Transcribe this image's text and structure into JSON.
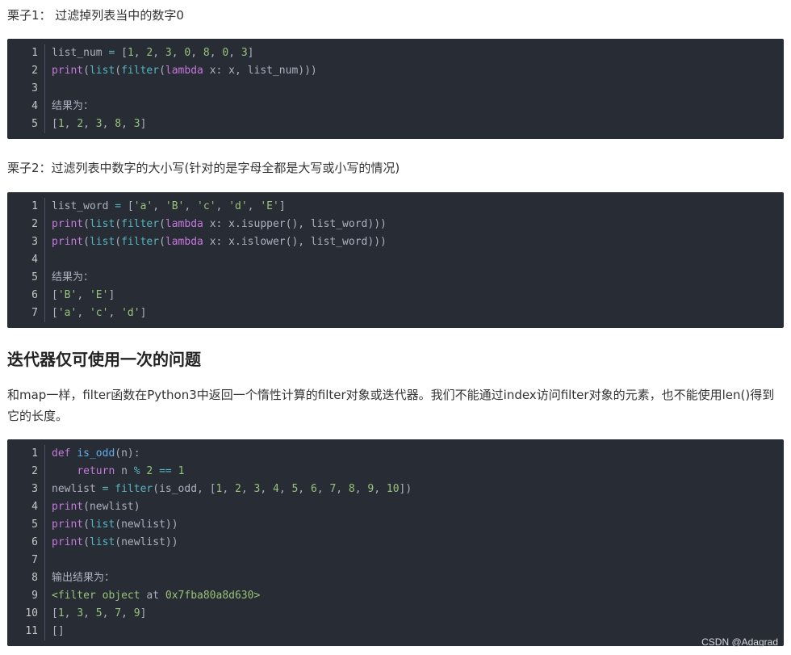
{
  "example1": {
    "title": "栗子1： 过滤掉列表当中的数字0",
    "lines": [
      {
        "num": "1",
        "tokens": [
          [
            "p",
            "list_num "
          ],
          [
            "o",
            "="
          ],
          [
            "p",
            " ["
          ],
          [
            "n",
            "1"
          ],
          [
            "p",
            ", "
          ],
          [
            "n",
            "2"
          ],
          [
            "p",
            ", "
          ],
          [
            "n",
            "3"
          ],
          [
            "p",
            ", "
          ],
          [
            "n",
            "0"
          ],
          [
            "p",
            ", "
          ],
          [
            "n",
            "8"
          ],
          [
            "p",
            ", "
          ],
          [
            "n",
            "0"
          ],
          [
            "p",
            ", "
          ],
          [
            "n",
            "3"
          ],
          [
            "p",
            "]"
          ]
        ]
      },
      {
        "num": "2",
        "tokens": [
          [
            "k",
            "print"
          ],
          [
            "p",
            "("
          ],
          [
            "b",
            "list"
          ],
          [
            "p",
            "("
          ],
          [
            "b",
            "filter"
          ],
          [
            "p",
            "("
          ],
          [
            "k",
            "lambda"
          ],
          [
            "p",
            " x: x, list_num)))"
          ]
        ]
      },
      {
        "num": "3",
        "tokens": []
      },
      {
        "num": "4",
        "tokens": [
          [
            "p",
            "结果为："
          ]
        ]
      },
      {
        "num": "5",
        "tokens": [
          [
            "p",
            "["
          ],
          [
            "n",
            "1"
          ],
          [
            "p",
            ", "
          ],
          [
            "n",
            "2"
          ],
          [
            "p",
            ", "
          ],
          [
            "n",
            "3"
          ],
          [
            "p",
            ", "
          ],
          [
            "n",
            "8"
          ],
          [
            "p",
            ", "
          ],
          [
            "n",
            "3"
          ],
          [
            "p",
            "]"
          ]
        ]
      }
    ]
  },
  "example2": {
    "title": "栗子2：过滤列表中数字的大小写(针对的是字母全都是大写或小写的情况)",
    "lines": [
      {
        "num": "1",
        "tokens": [
          [
            "p",
            "list_word "
          ],
          [
            "o",
            "="
          ],
          [
            "p",
            " ["
          ],
          [
            "s",
            "'a'"
          ],
          [
            "p",
            ", "
          ],
          [
            "s",
            "'B'"
          ],
          [
            "p",
            ", "
          ],
          [
            "s",
            "'c'"
          ],
          [
            "p",
            ", "
          ],
          [
            "s",
            "'d'"
          ],
          [
            "p",
            ", "
          ],
          [
            "s",
            "'E'"
          ],
          [
            "p",
            "]"
          ]
        ]
      },
      {
        "num": "2",
        "tokens": [
          [
            "k",
            "print"
          ],
          [
            "p",
            "("
          ],
          [
            "b",
            "list"
          ],
          [
            "p",
            "("
          ],
          [
            "b",
            "filter"
          ],
          [
            "p",
            "("
          ],
          [
            "k",
            "lambda"
          ],
          [
            "p",
            " x: x.isupper(), list_word)))"
          ]
        ]
      },
      {
        "num": "3",
        "tokens": [
          [
            "k",
            "print"
          ],
          [
            "p",
            "("
          ],
          [
            "b",
            "list"
          ],
          [
            "p",
            "("
          ],
          [
            "b",
            "filter"
          ],
          [
            "p",
            "("
          ],
          [
            "k",
            "lambda"
          ],
          [
            "p",
            " x: x.islower(), list_word)))"
          ]
        ]
      },
      {
        "num": "4",
        "tokens": []
      },
      {
        "num": "5",
        "tokens": [
          [
            "p",
            "结果为："
          ]
        ]
      },
      {
        "num": "6",
        "tokens": [
          [
            "p",
            "["
          ],
          [
            "s",
            "'B'"
          ],
          [
            "p",
            ", "
          ],
          [
            "s",
            "'E'"
          ],
          [
            "p",
            "]"
          ]
        ]
      },
      {
        "num": "7",
        "tokens": [
          [
            "p",
            "["
          ],
          [
            "s",
            "'a'"
          ],
          [
            "p",
            ", "
          ],
          [
            "s",
            "'c'"
          ],
          [
            "p",
            ", "
          ],
          [
            "s",
            "'d'"
          ],
          [
            "p",
            "]"
          ]
        ]
      }
    ]
  },
  "section": {
    "heading": "迭代器仅可使用一次的问题",
    "paragraph": "和map一样，filter函数在Python3中返回一个惰性计算的filter对象或迭代器。我们不能通过index访问filter对象的元素，也不能使用len()得到它的长度。"
  },
  "example3": {
    "lines": [
      {
        "num": "1",
        "tokens": [
          [
            "k",
            "def"
          ],
          [
            "p",
            " "
          ],
          [
            "f",
            "is_odd"
          ],
          [
            "p",
            "(n):"
          ]
        ]
      },
      {
        "num": "2",
        "tokens": [
          [
            "p",
            "    "
          ],
          [
            "k",
            "return"
          ],
          [
            "p",
            " n "
          ],
          [
            "o",
            "%"
          ],
          [
            "p",
            " "
          ],
          [
            "n",
            "2"
          ],
          [
            "p",
            " "
          ],
          [
            "o",
            "=="
          ],
          [
            "p",
            " "
          ],
          [
            "n",
            "1"
          ]
        ]
      },
      {
        "num": "3",
        "tokens": [
          [
            "p",
            "newlist "
          ],
          [
            "o",
            "="
          ],
          [
            "p",
            " "
          ],
          [
            "b",
            "filter"
          ],
          [
            "p",
            "(is_odd, ["
          ],
          [
            "n",
            "1"
          ],
          [
            "p",
            ", "
          ],
          [
            "n",
            "2"
          ],
          [
            "p",
            ", "
          ],
          [
            "n",
            "3"
          ],
          [
            "p",
            ", "
          ],
          [
            "n",
            "4"
          ],
          [
            "p",
            ", "
          ],
          [
            "n",
            "5"
          ],
          [
            "p",
            ", "
          ],
          [
            "n",
            "6"
          ],
          [
            "p",
            ", "
          ],
          [
            "n",
            "7"
          ],
          [
            "p",
            ", "
          ],
          [
            "n",
            "8"
          ],
          [
            "p",
            ", "
          ],
          [
            "n",
            "9"
          ],
          [
            "p",
            ", "
          ],
          [
            "n",
            "10"
          ],
          [
            "p",
            "])"
          ]
        ]
      },
      {
        "num": "4",
        "tokens": [
          [
            "k",
            "print"
          ],
          [
            "p",
            "(newlist)"
          ]
        ]
      },
      {
        "num": "5",
        "tokens": [
          [
            "k",
            "print"
          ],
          [
            "p",
            "("
          ],
          [
            "b",
            "list"
          ],
          [
            "p",
            "(newlist))"
          ]
        ]
      },
      {
        "num": "6",
        "tokens": [
          [
            "k",
            "print"
          ],
          [
            "p",
            "("
          ],
          [
            "b",
            "list"
          ],
          [
            "p",
            "(newlist))"
          ]
        ]
      },
      {
        "num": "7",
        "tokens": []
      },
      {
        "num": "8",
        "tokens": [
          [
            "p",
            "输出结果为："
          ]
        ]
      },
      {
        "num": "9",
        "tokens": [
          [
            "g",
            "<filter object "
          ],
          [
            "p",
            "at"
          ],
          [
            "g",
            " 0x7fba80a8d630>"
          ]
        ]
      },
      {
        "num": "10",
        "tokens": [
          [
            "p",
            "["
          ],
          [
            "n",
            "1"
          ],
          [
            "p",
            ", "
          ],
          [
            "n",
            "3"
          ],
          [
            "p",
            ", "
          ],
          [
            "n",
            "5"
          ],
          [
            "p",
            ", "
          ],
          [
            "n",
            "7"
          ],
          [
            "p",
            ", "
          ],
          [
            "n",
            "9"
          ],
          [
            "p",
            "]"
          ]
        ]
      },
      {
        "num": "11",
        "tokens": [
          [
            "p",
            "[]"
          ]
        ]
      }
    ]
  },
  "watermark": "CSDN @Adagrad"
}
